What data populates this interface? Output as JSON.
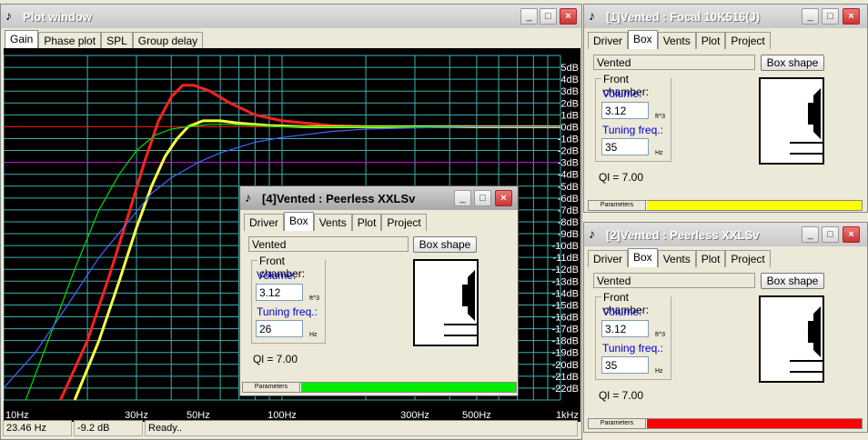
{
  "plot_window": {
    "title": "Plot window",
    "tabs": [
      "Gain",
      "Phase plot",
      "SPL",
      "Group delay"
    ],
    "status": {
      "freq": "23.46 Hz",
      "gain": "-9.2 dB",
      "state": "Ready.."
    }
  },
  "chart_data": {
    "type": "line",
    "x_scale": "log",
    "xlim": [
      10,
      1000
    ],
    "ylim": [
      -23,
      6
    ],
    "grid": true,
    "y_tick_labels": [
      "5dB",
      "4dB",
      "3dB",
      "2dB",
      "1dB",
      "0dB",
      "-1dB",
      "-2dB",
      "-3dB",
      "-4dB",
      "-5dB",
      "-6dB",
      "-7dB",
      "-8dB",
      "-9dB",
      "-10dB",
      "-11dB",
      "-12dB",
      "-13dB",
      "-14dB",
      "-15dB",
      "-16dB",
      "-17dB",
      "-18dB",
      "-19dB",
      "-20dB",
      "-21dB",
      "-22dB"
    ],
    "x_tick_labels": [
      "10Hz",
      "30Hz",
      "50Hz",
      "100Hz",
      "300Hz",
      "500Hz",
      "1kHz"
    ],
    "reference_lines": [
      {
        "y": 0,
        "color": "#ff0000"
      },
      {
        "y": -3,
        "color": "#cc00cc"
      }
    ],
    "series": [
      {
        "color": "#ff2020",
        "width": 3,
        "x": [
          16,
          20,
          24,
          28,
          32,
          36,
          40,
          44,
          48,
          55,
          65,
          80,
          100,
          150,
          200,
          300,
          400,
          1000
        ],
        "y": [
          -23,
          -18,
          -12.5,
          -7.5,
          -3,
          0.5,
          2.5,
          3.5,
          3.5,
          3,
          2,
          1,
          0.5,
          0.1,
          0,
          0,
          0,
          0
        ]
      },
      {
        "color": "#ffff40",
        "width": 3,
        "x": [
          18,
          22,
          26,
          30,
          34,
          38,
          42,
          46,
          52,
          60,
          70,
          90,
          120,
          200,
          300,
          1000
        ],
        "y": [
          -23,
          -18,
          -13,
          -8.5,
          -5,
          -2.5,
          -1,
          0,
          0.5,
          0.5,
          0.3,
          0.1,
          0,
          0,
          0,
          0
        ]
      },
      {
        "color": "#00dd00",
        "width": 1.2,
        "x": [
          12,
          15,
          18,
          22,
          26,
          30,
          35,
          40,
          46,
          55,
          65,
          80,
          100,
          200,
          1000
        ],
        "y": [
          -23,
          -17,
          -12,
          -7,
          -4,
          -2,
          -0.7,
          -0.2,
          0,
          0.2,
          0.2,
          0.1,
          0,
          0,
          0
        ]
      },
      {
        "color": "#4466ff",
        "width": 1.2,
        "x": [
          10,
          13,
          17,
          22,
          28,
          34,
          40,
          50,
          60,
          80,
          100,
          150,
          200,
          300,
          500,
          1000
        ],
        "y": [
          -22,
          -19,
          -15,
          -11,
          -8,
          -5.6,
          -4.3,
          -3,
          -2.2,
          -1.3,
          -0.9,
          -0.4,
          -0.2,
          -0.1,
          0,
          0
        ]
      }
    ]
  },
  "win1": {
    "title": "[1]Vented : Focal 10K516(J)",
    "tabs": [
      "Driver",
      "Box",
      "Vents",
      "Plot",
      "Project"
    ],
    "box_type": "Vented",
    "box_shape": "Box shape",
    "front_chamber": "Front chamber:",
    "volume_label": "Volume:",
    "volume": "3.12",
    "volume_unit": "ft^3",
    "tuning_label": "Tuning freq.:",
    "tuning": "35",
    "tuning_unit": "Hz",
    "ql": "Ql = 7.00",
    "params": "Parameters",
    "bar_color": "#ffff00"
  },
  "win2": {
    "title": "[2]Vented : Peerless XXLSv",
    "tabs": [
      "Driver",
      "Box",
      "Vents",
      "Plot",
      "Project"
    ],
    "box_type": "Vented",
    "box_shape": "Box shape",
    "front_chamber": "Front chamber:",
    "volume_label": "Volume:",
    "volume": "3.12",
    "volume_unit": "ft^3",
    "tuning_label": "Tuning freq.:",
    "tuning": "35",
    "tuning_unit": "Hz",
    "ql": "Ql = 7.00",
    "params": "Parameters",
    "bar_color": "#ff0000"
  },
  "win4": {
    "title": "[4]Vented : Peerless XXLSv",
    "tabs": [
      "Driver",
      "Box",
      "Vents",
      "Plot",
      "Project"
    ],
    "box_type": "Vented",
    "box_shape": "Box shape",
    "front_chamber": "Front chamber:",
    "volume_label": "Volume:",
    "volume": "3.12",
    "volume_unit": "ft^3",
    "tuning_label": "Tuning freq.:",
    "tuning": "26",
    "tuning_unit": "Hz",
    "ql": "Ql = 7.00",
    "params": "Parameters",
    "bar_color": "#00ee00"
  },
  "icons": {
    "app": "speaker-app-icon",
    "minimize": "minimize-icon",
    "maximize": "maximize-icon",
    "close": "close-icon"
  }
}
